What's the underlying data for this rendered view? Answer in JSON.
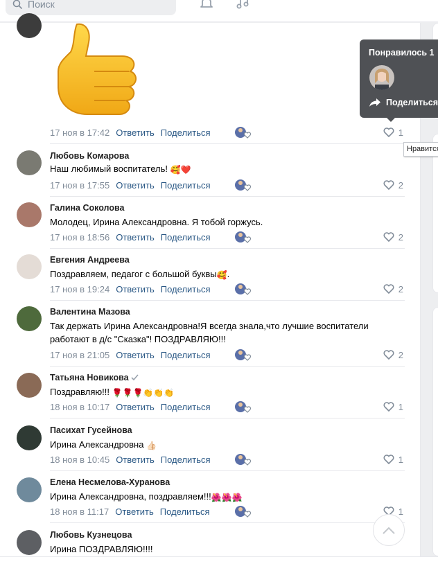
{
  "header": {
    "search_placeholder": "Поиск",
    "search_icon": "search-icon",
    "bell_icon": "bell-icon",
    "music_icon": "music-icon"
  },
  "top_comment": {
    "sticker": "thumbs-up-sticker",
    "date": "17 ноя в 17:42",
    "reply": "Ответить",
    "share": "Поделиться",
    "likes": "1"
  },
  "comments": [
    {
      "name": "Любовь Комарова",
      "text": "Наш любимый воспитатель! ",
      "emoji": "🥰❤️",
      "date": "17 ноя в 17:55",
      "likes": "2"
    },
    {
      "name": "Галина Соколова",
      "text": "Молодец, Ирина Александровна. Я тобой горжусь.",
      "date": "17 ноя в 18:56",
      "likes": "2"
    },
    {
      "name": "Евгения Андреева",
      "text": "Поздравляем, педагог с большой буквы",
      "emoji": "🥰",
      "text_after": ".",
      "date": "17 ноя в 19:24",
      "likes": "2"
    },
    {
      "name": "Валентина Мазова",
      "text": "Так держать Ирина Александровна!Я всегда знала,что лучшие воспитатели работают в д/с \"Сказка\"! ПОЗДРАВЛЯЮ!!!",
      "date": "17 ноя в 21:05",
      "likes": "2"
    },
    {
      "name": "Татьяна Новикова",
      "verified_icon": "check-icon",
      "text": "Поздравляю!!! ",
      "emoji": "🌹🌹🌹👏👏👏",
      "date": "18 ноя в 10:17",
      "likes": "1"
    },
    {
      "name": "Пасихат Гусейнова",
      "text": "Ирина Александровна ",
      "emoji": "👍🏻",
      "date": "18 ноя в 10:45",
      "likes": "1"
    },
    {
      "name": "Елена Несмелова-Хуранова",
      "text": "Ирина Александровна, поздравляем!!!",
      "emoji": "🌺🌺🌺",
      "date": "18 ноя в 11:17",
      "likes": "1"
    },
    {
      "name": "Любовь Кузнецова",
      "text": "Ирина ПОЗДРАВЛЯЮ!!!!"
    }
  ],
  "actions": {
    "reply": "Ответить",
    "share": "Поделиться"
  },
  "tooltip": {
    "title": "Понравилось 1",
    "share": "Поделиться"
  },
  "hint": "Нравится",
  "colors": {
    "link": "#2a5885",
    "muted": "#818c99",
    "tooltip_bg": "#4f5155"
  }
}
